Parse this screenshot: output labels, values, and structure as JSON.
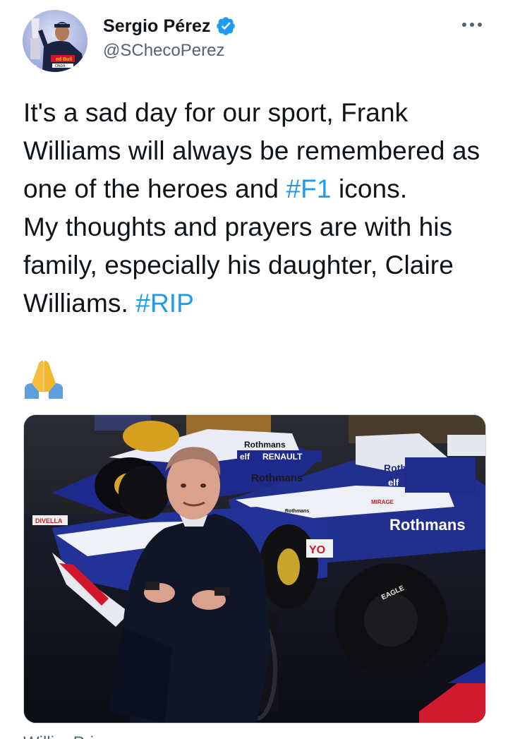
{
  "tweet": {
    "author": {
      "display_name": "Sergio Pérez",
      "handle": "@SChecoPerez",
      "verified": true,
      "avatar_icon": "driver-with-trophy-avatar"
    },
    "more_icon": "more-options-icon",
    "text": {
      "line_parts": [
        {
          "type": "text",
          "value": "It's a sad day for our sport, Frank Williams will always be remembered as one of the heroes and "
        },
        {
          "type": "hashtag",
          "value": "#F1"
        },
        {
          "type": "text",
          "value": " icons."
        },
        {
          "type": "break"
        },
        {
          "type": "text",
          "value": "My thoughts and prayers are with his family, especially his daughter, Claire Williams. "
        },
        {
          "type": "hashtag",
          "value": "#RIP"
        }
      ],
      "emoji": "🙏",
      "emoji_name": "folded-hands-emoji"
    },
    "media": {
      "description_icon": "photo-frank-williams-with-williams-f1-cars",
      "car_sponsor_labels": [
        "Rothmans",
        "elf",
        "RENAULT",
        "Rothmans",
        "Rothmans",
        "Rothmans",
        "YO",
        "DIVELLA",
        "EAGLE",
        "MIRAGE"
      ]
    },
    "footer": {
      "partial_text": "Willi... Prior..."
    }
  },
  "colors": {
    "text": "#0f1419",
    "secondary": "#536471",
    "accent": "#1d9bf0",
    "verified": "#1d9bf0"
  }
}
